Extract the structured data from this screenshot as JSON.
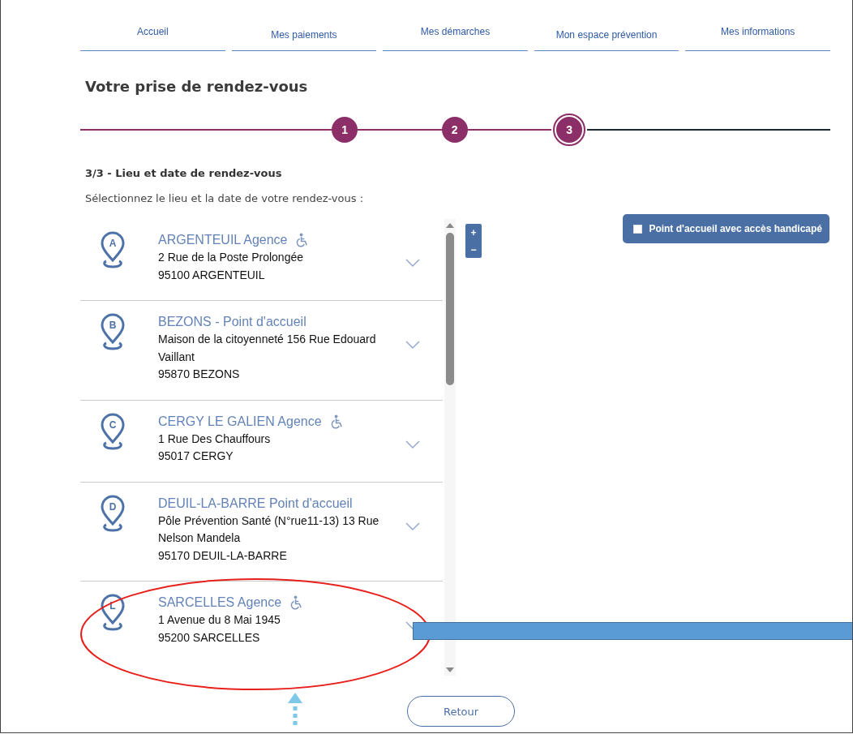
{
  "nav_tabs": [
    {
      "label": "Accueil"
    },
    {
      "label": "Mes paiements"
    },
    {
      "label": "Mes démarches"
    },
    {
      "label": "Mon espace prévention"
    },
    {
      "label": "Mes informations"
    }
  ],
  "title": "Votre prise de rendez-vous",
  "steps": [
    {
      "label": "1",
      "current": false
    },
    {
      "label": "2",
      "current": false
    },
    {
      "label": "3",
      "current": true
    }
  ],
  "section_title": "3/3 - Lieu et date de rendez-vous",
  "instruction": "Sélectionnez le lieu et la date de votre rendez-vous :",
  "locations": [
    {
      "marker": "A",
      "name": "ARGENTEUIL Agence",
      "accessible": true,
      "address": [
        "2 Rue de la Poste Prolongée",
        "95100 ARGENTEUIL"
      ]
    },
    {
      "marker": "B",
      "name": "BEZONS - Point d'accueil",
      "accessible": false,
      "address": [
        "Maison de la citoyenneté 156 Rue Edouard Vaillant",
        "95870 BEZONS"
      ]
    },
    {
      "marker": "C",
      "name": "CERGY LE GALIEN Agence",
      "accessible": true,
      "address": [
        "1 Rue Des Chauffours",
        "95017 CERGY"
      ]
    },
    {
      "marker": "D",
      "name": "DEUIL-LA-BARRE Point d'accueil",
      "accessible": false,
      "address": [
        "Pôle Prévention Santé (N°rue11-13) 13 Rue Nelson Mandela",
        "95170 DEUIL-LA-BARRE"
      ]
    },
    {
      "marker": "L",
      "name": "SARCELLES Agence",
      "accessible": true,
      "address": [
        "1 Avenue du 8 Mai 1945",
        "95200 SARCELLES"
      ]
    }
  ],
  "map_zoom": [
    "+",
    "−"
  ],
  "filter": {
    "label": "Point d'accueil avec accès handicapé",
    "checked": false
  },
  "back_button": "Retour"
}
